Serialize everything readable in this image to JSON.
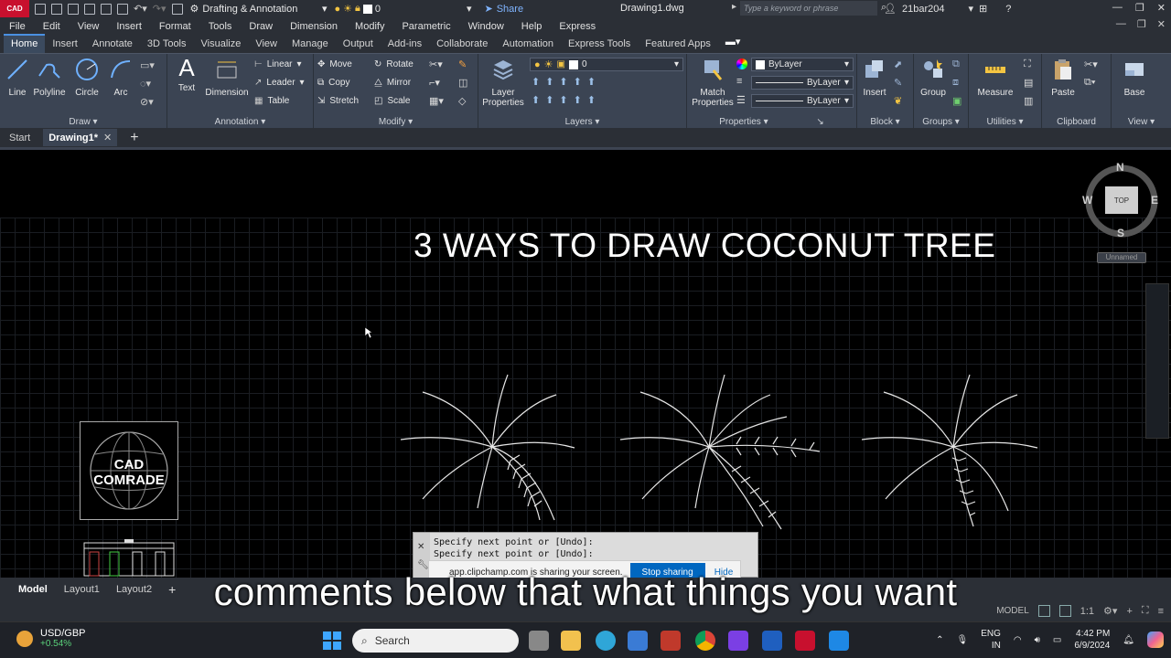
{
  "titlebar": {
    "app_badge": "CAD",
    "workspace": "Drafting & Annotation",
    "layer_value": "0",
    "share_label": "Share",
    "document_title": "Drawing1.dwg",
    "search_placeholder": "Type a keyword or phrase",
    "username": "21bar204"
  },
  "menu": [
    "File",
    "Edit",
    "View",
    "Insert",
    "Format",
    "Tools",
    "Draw",
    "Dimension",
    "Modify",
    "Parametric",
    "Window",
    "Help",
    "Express"
  ],
  "ribbon_tabs": [
    "Home",
    "Insert",
    "Annotate",
    "3D Tools",
    "Visualize",
    "View",
    "Manage",
    "Output",
    "Add-ins",
    "Collaborate",
    "Automation",
    "Express Tools",
    "Featured Apps"
  ],
  "ribbon": {
    "draw": {
      "title": "Draw",
      "tools": [
        "Line",
        "Polyline",
        "Circle",
        "Arc"
      ]
    },
    "annotation": {
      "title": "Annotation",
      "text": "Text",
      "dimension": "Dimension",
      "linear": "Linear",
      "leader": "Leader",
      "table": "Table"
    },
    "modify": {
      "title": "Modify",
      "move": "Move",
      "rotate": "Rotate",
      "copy": "Copy",
      "mirror": "Mirror",
      "stretch": "Stretch",
      "scale": "Scale"
    },
    "layers": {
      "title": "Layers",
      "layer_properties_1": "Layer",
      "layer_properties_2": "Properties",
      "current_layer": "0"
    },
    "properties": {
      "title": "Properties",
      "match_1": "Match",
      "match_2": "Properties",
      "color": "ByLayer",
      "linetype": "ByLayer",
      "lineweight": "ByLayer"
    },
    "block": {
      "title": "Block",
      "insert": "Insert"
    },
    "groups": {
      "title": "Groups",
      "group": "Group"
    },
    "utilities": {
      "title": "Utilities",
      "measure": "Measure"
    },
    "clipboard": {
      "title": "Clipboard",
      "paste": "Paste"
    },
    "view": {
      "title": "View",
      "base": "Base"
    }
  },
  "doc_tabs": {
    "start": "Start",
    "active": "Drawing1*"
  },
  "canvas": {
    "headline": "3 WAYS TO DRAW COCONUT TREE",
    "logo_line1": "CAD",
    "logo_line2": "COMRADE",
    "viewcube": {
      "n": "N",
      "s": "S",
      "e": "E",
      "w": "W",
      "top": "TOP",
      "ucs": "Unnamed"
    }
  },
  "command_line": {
    "line1": "Specify next point or [Undo]:",
    "line2": "Specify next point or [Undo]:"
  },
  "screen_share": {
    "message": "app.clipchamp.com is sharing your screen.",
    "stop": "Stop sharing",
    "hide": "Hide"
  },
  "layout_tabs": [
    "Model",
    "Layout1",
    "Layout2"
  ],
  "status": {
    "model": "MODEL",
    "scale": "1:1"
  },
  "subtitle": "comments below that what things you want",
  "taskbar": {
    "ticker_name": "USD/GBP",
    "ticker_change": "+0.54%",
    "search": "Search",
    "lang1": "ENG",
    "lang2": "IN",
    "time": "4:42 PM",
    "date": "6/9/2024"
  }
}
